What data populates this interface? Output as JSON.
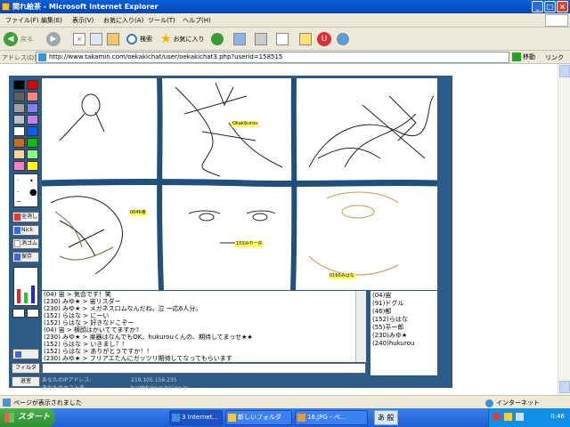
{
  "window": {
    "title": "関れ絵茶 - Microsoft Internet Explorer"
  },
  "menu": [
    "ファイル(F)",
    "編集(E)",
    "表示(V)",
    "お気に入り(A)",
    "ツール(T)",
    "ヘルプ(H)"
  ],
  "toolbar": {
    "back": "戻る",
    "search": "検索",
    "favorites": "お気に入り"
  },
  "address": {
    "label": "アドレス(D)",
    "url": "http://www.takamin.com/oekakichat/user/oekakichat3.php?userid=158515",
    "go": "移動",
    "links": "リンク"
  },
  "palette": {
    "colors": [
      "#000000",
      "#e00000",
      "#606060",
      "#ff8080",
      "#a0a0a0",
      "#8080ff",
      "#c0c0c0",
      "#c080ff",
      "#ffffff",
      "#0060ff",
      "#c07020",
      "#00c000",
      "#ffd0a0",
      "#80ff80",
      "#ff80c0",
      "#ffff00"
    ],
    "tools": [
      "全消し",
      "Nick",
      "消ゴム",
      "保存"
    ]
  },
  "canvas": {
    "labels": [
      "Okakikurou",
      "0046番",
      "153みや一弁",
      "0160みはな"
    ]
  },
  "chat": {
    "lines": [
      "(04) 宙 > 気合です！笑",
      "(230) みゆ★ > 宙リスダー",
      "(230) みゆ★ > メガネスロムなんだね。泣 一応6人分。",
      "(152) らはな > にーい",
      "(152) らはな > 好きなドこぞー",
      "(04) 宙 > 横顔はかいててますか?",
      "(230) みゆ★ > 楽器はなんでもOK。hukurouくんの、期待してまっせ★★",
      "(152) らはな > いきまし？！",
      "(152) らはな > ありがとうですか！！",
      "(230) みゆ★ > フリアエたんにガッツリ期待してなってもらいます"
    ],
    "users": [
      "(04)宙",
      "(91)ドグル",
      "(46)郁",
      "(152)らはな",
      "(55)平一郎",
      "(230)みゆ★",
      "(240)hukurou"
    ],
    "filter_label": "フィルタ",
    "leave_label": "退室",
    "info": [
      {
        "label": "あなたのIPアドレス:",
        "value": "219.105.156.235"
      },
      {
        "label": "あなたのホスト名:",
        "value": "baidbfakocc.bai.ne.jp"
      }
    ]
  },
  "status": {
    "text": "ページが表示されました",
    "zone": "インターネット"
  },
  "taskbar": {
    "start": "スタート",
    "tasks": [
      "3 Internet...",
      "新しいフォルダ",
      "16.JPG - ペ..."
    ],
    "ime": "あ 般",
    "clock": "0:46"
  }
}
